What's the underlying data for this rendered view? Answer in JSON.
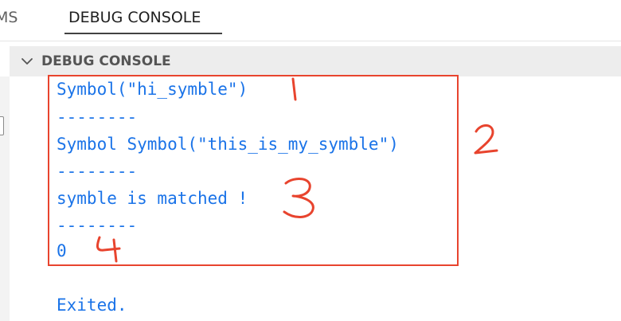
{
  "tabs": {
    "problems_label": "EMS",
    "debug_console_label": "DEBUG CONSOLE"
  },
  "section": {
    "title": "DEBUG CONSOLE",
    "toggle_icon": "chevron-down-icon"
  },
  "console": {
    "lines": [
      "Symbol(\"hi_symble\")",
      "--------",
      "Symbol Symbol(\"this_is_my_symble\")",
      "--------",
      "symble is matched !",
      "--------",
      "0"
    ],
    "exit_message": "Exited."
  },
  "annotations": {
    "marks": [
      "1",
      "2",
      "3",
      "4"
    ]
  },
  "colors": {
    "console_text": "#1a73e8",
    "annotation": "#e8442e"
  }
}
